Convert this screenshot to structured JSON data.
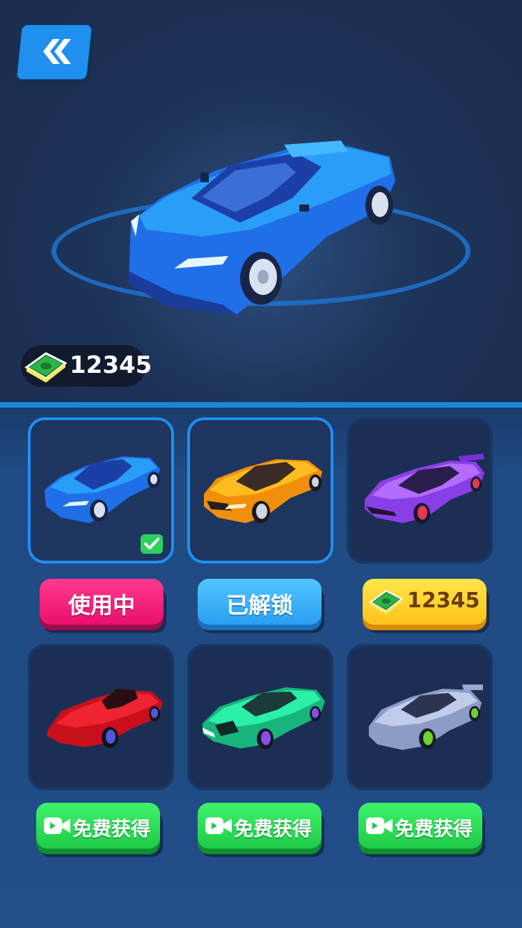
{
  "header": {
    "back_icon": "double-chevron-left-icon",
    "balance": "12345"
  },
  "colors": {
    "accent": "#1e8ff2",
    "pink": "#ff3a90",
    "green": "#2dcf5e",
    "yellow": "#ffd02e"
  },
  "cars": [
    {
      "color": "blue",
      "state": "in_use",
      "button_label": "使用中"
    },
    {
      "color": "orange",
      "state": "unlocked",
      "button_label": "已解锁"
    },
    {
      "color": "purple",
      "state": "price",
      "button_label": "12345"
    },
    {
      "color": "red",
      "state": "free_ad",
      "button_label": "免费获得"
    },
    {
      "color": "green",
      "state": "free_ad",
      "button_label": "免费获得"
    },
    {
      "color": "silver",
      "state": "free_ad",
      "button_label": "免费获得"
    }
  ]
}
